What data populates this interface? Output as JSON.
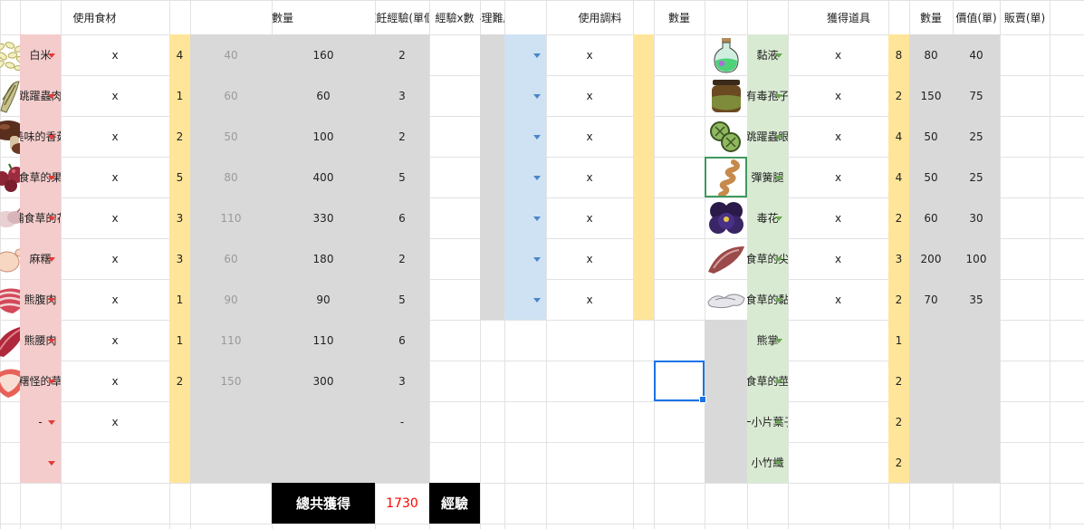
{
  "headers": {
    "ingredient": "使用食材",
    "qty": "數量",
    "unit_exp": "烹飪經驗(單個)",
    "exp_x_qty": "經驗x數",
    "difficulty": "料理難度",
    "seasoning": "使用調料",
    "seasoning_qty": "數量",
    "obtained": "獲得道具",
    "obtained_qty": "數量",
    "price": "價值(單)",
    "sell": "販賣(單)"
  },
  "ingredients": [
    {
      "name": "白米",
      "icon": "rice-icon",
      "x": "x",
      "qty": "4",
      "unit_exp": "40",
      "exp": "160",
      "diff": "2"
    },
    {
      "name": "跳躍蟲肉",
      "icon": "bug-meat-icon",
      "x": "x",
      "qty": "1",
      "unit_exp": "60",
      "exp": "60",
      "diff": "3"
    },
    {
      "name": "美味的香菇",
      "icon": "mushroom-icon",
      "x": "x",
      "qty": "2",
      "unit_exp": "50",
      "exp": "100",
      "diff": "2"
    },
    {
      "name": "捕食草的果實",
      "icon": "berry-icon",
      "x": "x",
      "qty": "5",
      "unit_exp": "80",
      "exp": "400",
      "diff": "5"
    },
    {
      "name": "捕食草的花",
      "icon": "flower-icon",
      "x": "x",
      "qty": "3",
      "unit_exp": "110",
      "exp": "330",
      "diff": "6"
    },
    {
      "name": "麻糬",
      "icon": "mochi-icon",
      "x": "x",
      "qty": "3",
      "unit_exp": "60",
      "exp": "180",
      "diff": "2"
    },
    {
      "name": "熊腹肉",
      "icon": "belly-meat-icon",
      "x": "x",
      "qty": "1",
      "unit_exp": "90",
      "exp": "90",
      "diff": "5"
    },
    {
      "name": "熊腰肉",
      "icon": "loin-meat-icon",
      "x": "x",
      "qty": "1",
      "unit_exp": "110",
      "exp": "110",
      "diff": "6"
    },
    {
      "name": "麻糬怪的草莓",
      "icon": "strawberry-icon",
      "x": "x",
      "qty": "2",
      "unit_exp": "150",
      "exp": "300",
      "diff": "3"
    },
    {
      "name": "-",
      "icon": "",
      "x": "x",
      "qty": "",
      "unit_exp": "",
      "exp": "",
      "diff": "-"
    },
    {
      "name": "",
      "icon": "",
      "x": "",
      "qty": "",
      "unit_exp": "",
      "exp": "",
      "diff": ""
    }
  ],
  "seasoning_rows": [
    {
      "x": "x"
    },
    {
      "x": "x"
    },
    {
      "x": "x"
    },
    {
      "x": "x"
    },
    {
      "x": "x"
    },
    {
      "x": "x"
    },
    {
      "x": "x"
    }
  ],
  "obtained": [
    {
      "name": "黏液",
      "icon": "potion-icon",
      "x": "x",
      "qty": "8",
      "price": "80",
      "sell": "40"
    },
    {
      "name": "有毒孢子",
      "icon": "jar-icon",
      "x": "x",
      "qty": "2",
      "price": "150",
      "sell": "75"
    },
    {
      "name": "跳躍蟲眼",
      "icon": "bug-eye-icon",
      "x": "x",
      "qty": "4",
      "price": "50",
      "sell": "25"
    },
    {
      "name": "彈簧腿",
      "icon": "spring-leg-icon",
      "x": "x",
      "qty": "4",
      "price": "50",
      "sell": "25"
    },
    {
      "name": "毒花",
      "icon": "pansy-icon",
      "x": "x",
      "qty": "2",
      "price": "60",
      "sell": "30"
    },
    {
      "name": "捕食草的尖牙",
      "icon": "fang-icon",
      "x": "x",
      "qty": "3",
      "price": "200",
      "sell": "100"
    },
    {
      "name": "捕食草的黏液",
      "icon": "slime-icon",
      "x": "x",
      "qty": "2",
      "price": "70",
      "sell": "35"
    },
    {
      "name": "熊掌",
      "icon": "",
      "x": "",
      "qty": "1",
      "price": "",
      "sell": ""
    },
    {
      "name": "捕食草的莖塊",
      "icon": "",
      "x": "",
      "qty": "2",
      "price": "",
      "sell": ""
    },
    {
      "name": "一小片葉子",
      "icon": "",
      "x": "",
      "qty": "2",
      "price": "",
      "sell": ""
    },
    {
      "name": "小竹纖",
      "icon": "",
      "x": "",
      "qty": "2",
      "price": "",
      "sell": ""
    }
  ],
  "total": {
    "label": "總共獲得",
    "value": "1730",
    "unit": "經驗",
    "value_color": "#ff0000"
  },
  "colors": {
    "pink": "#f4cccc",
    "yellow": "#ffe599",
    "gray": "#d9d9d9",
    "blue": "#cfe2f3",
    "green": "#d9ead3"
  }
}
